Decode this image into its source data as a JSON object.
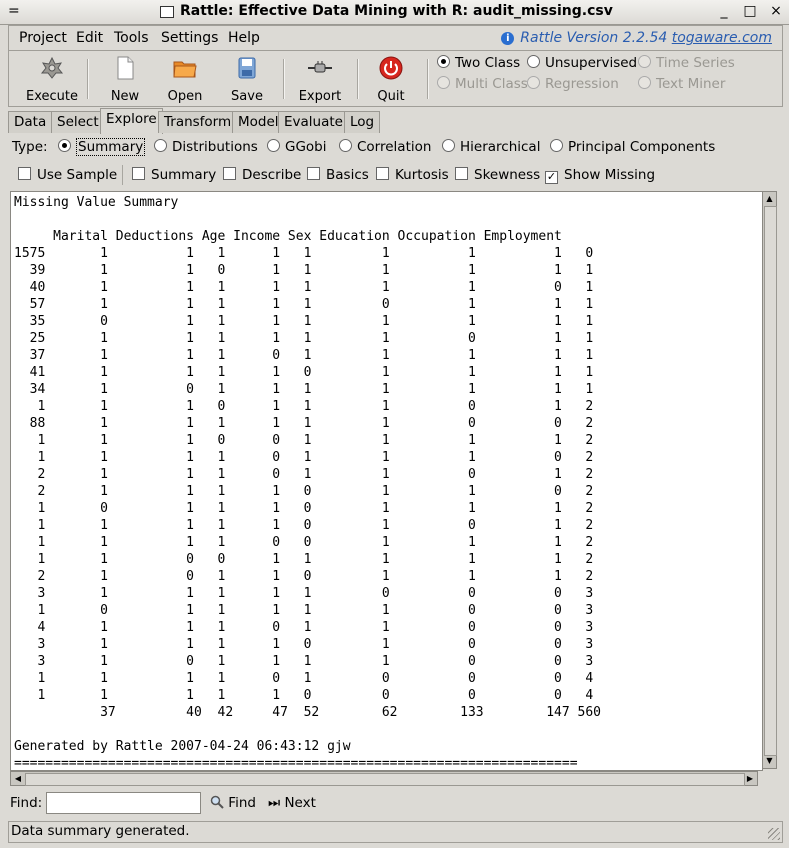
{
  "window": {
    "title": "Rattle: Effective Data Mining with R: audit_missing.csv",
    "menu_glyph": "=",
    "controls": [
      "_",
      "□",
      "×"
    ]
  },
  "menu": {
    "items": [
      "Project",
      "Edit",
      "Tools",
      "Settings",
      "Help"
    ],
    "version_text": "Rattle Version 2.2.54",
    "version_link": "togaware.com"
  },
  "toolbar": {
    "buttons": [
      "Execute",
      "New",
      "Open",
      "Save",
      "Export",
      "Quit"
    ],
    "mode_options": {
      "two_class": "Two Class",
      "unsupervised": "Unsupervised",
      "time_series": "Time Series",
      "multi_class": "Multi Class",
      "regression": "Regression",
      "text_miner": "Text Miner"
    },
    "selected_mode": "Two Class"
  },
  "tabs": [
    "Data",
    "Select",
    "Explore",
    "Transform",
    "Model",
    "Evaluate",
    "Log"
  ],
  "active_tab": "Explore",
  "explore": {
    "type_label": "Type:",
    "types": [
      "Summary",
      "Distributions",
      "GGobi",
      "Correlation",
      "Hierarchical",
      "Principal Components"
    ],
    "selected_type": "Summary",
    "options": [
      {
        "label": "Use Sample",
        "checked": false
      },
      {
        "label": "Summary",
        "checked": false
      },
      {
        "label": "Describe",
        "checked": false
      },
      {
        "label": "Basics",
        "checked": false
      },
      {
        "label": "Kurtosis",
        "checked": false
      },
      {
        "label": "Skewness",
        "checked": false
      },
      {
        "label": "Show Missing",
        "checked": true
      }
    ]
  },
  "output": {
    "title": "Missing Value Summary",
    "header": "     Marital Deductions Age Income Sex Education Occupation Employment",
    "rows": [
      "1575       1          1   1      1   1         1          1          1   0",
      "  39       1          1   0      1   1         1          1          1   1",
      "  40       1          1   1      1   1         1          1          0   1",
      "  57       1          1   1      1   1         0          1          1   1",
      "  35       0          1   1      1   1         1          1          1   1",
      "  25       1          1   1      1   1         1          0          1   1",
      "  37       1          1   1      0   1         1          1          1   1",
      "  41       1          1   1      1   0         1          1          1   1",
      "  34       1          0   1      1   1         1          1          1   1",
      "   1       1          1   0      1   1         1          0          1   2",
      "  88       1          1   1      1   1         1          0          0   2",
      "   1       1          1   0      0   1         1          1          1   2",
      "   1       1          1   1      0   1         1          1          0   2",
      "   2       1          1   1      0   1         1          0          1   2",
      "   2       1          1   1      1   0         1          1          0   2",
      "   1       0          1   1      1   0         1          1          1   2",
      "   1       1          1   1      1   0         1          0          1   2",
      "   1       1          1   1      0   0         1          1          1   2",
      "   1       1          0   0      1   1         1          1          1   2",
      "   2       1          0   1      1   0         1          1          1   2",
      "   3       1          1   1      1   1         0          0          0   3",
      "   1       0          1   1      1   1         1          0          0   3",
      "   4       1          1   1      0   1         1          0          0   3",
      "   3       1          1   1      1   0         1          0          0   3",
      "   3       1          0   1      1   1         1          0          0   3",
      "   1       1          1   1      0   1         0          0          0   4",
      "   1       1          1   1      1   0         0          0          0   4",
      "           37         40  42     47  52        62        133        147 560"
    ],
    "footer": "Generated by Rattle 2007-04-24 06:43:12 gjw",
    "rule": "========================================================================"
  },
  "find": {
    "label": "Find:",
    "value": "",
    "find_button": "Find",
    "next_button": "Next"
  },
  "status": "Data summary generated."
}
